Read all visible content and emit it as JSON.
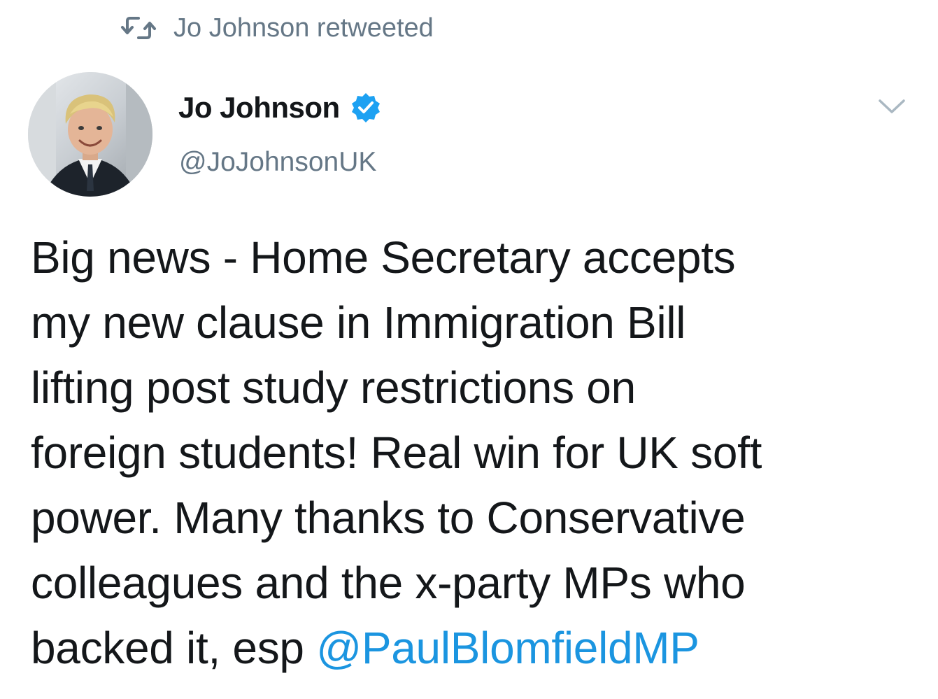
{
  "retweet": {
    "label": "Jo Johnson retweeted",
    "icon": "retweet-icon"
  },
  "author": {
    "display_name": "Jo Johnson",
    "handle": "@JoJohnsonUK",
    "verified": true,
    "verified_icon": "verified-badge-icon",
    "avatar": "profile-photo"
  },
  "menu": {
    "icon": "chevron-down-icon"
  },
  "tweet": {
    "text": "Big news - Home Secretary accepts\nmy new clause in Immigration Bill\nlifting post study restrictions on\nforeign students! Real win for UK soft\npower. Many thanks to Conservative\ncolleagues and the x-party MPs who\nbacked it, esp ",
    "mention": "@PaulBlomfieldMP"
  },
  "colors": {
    "text": "#14171a",
    "secondary": "#657786",
    "link": "#1b95e0",
    "verified": "#1da1f2"
  }
}
